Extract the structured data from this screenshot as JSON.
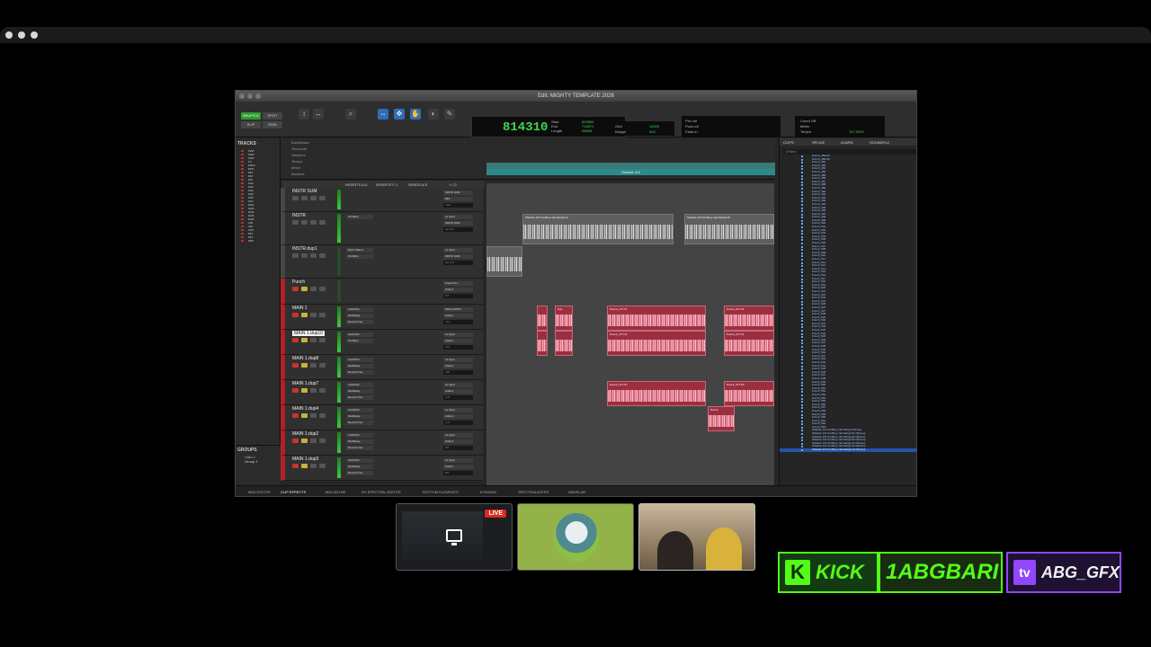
{
  "window_title": "Edit: MIGHTY TEMPLATE 2026",
  "toolbar": {
    "mode_shuffle": "SHUFFLE",
    "mode_spot": "SPOT",
    "mode_slip": "SLIP",
    "mode_grid": "GRID",
    "counter_main": "814310",
    "counter_labels": [
      "Start",
      "End",
      "Length"
    ],
    "counter_values": [
      "620864",
      "716672",
      "95808"
    ],
    "cursor_label": "Cursor",
    "cursor_value": "694516",
    "cursor_db": "-78.8dB",
    "grid_label": "Grid",
    "grid_value": "10000",
    "nudge_label": "Nudge",
    "nudge_value": "200",
    "preroll_label": "Pre-roll",
    "postroll_label": "Post-roll",
    "fade_label": "Fade-in",
    "count_off": "Count Off",
    "meter_label": "Meter",
    "tempo_label": "Tempo",
    "tempo_value": "147.0000"
  },
  "rulers": [
    "Bars|Beats",
    "Timecode",
    "Samples",
    "Tempo",
    "Meter",
    "Markers"
  ],
  "ruler_marker_text": "Default: 4/4",
  "tracks_panel": {
    "header": "TRACKS",
    "items": [
      "INST",
      "INST",
      "INST",
      "FX",
      "MAIN",
      "MNT",
      "MIX",
      "MIX",
      "MIX",
      "M12",
      "M13",
      "M14",
      "M15",
      "M16",
      "M17",
      "MAS",
      "MAS",
      "DUB",
      "DUB",
      "DUB",
      "LB1",
      "LB1",
      "VOX",
      "MIX",
      "MIX",
      "PEP"
    ]
  },
  "groups_panel": {
    "header": "GROUPS",
    "items": [
      "<ALL>",
      "Group 1"
    ]
  },
  "mix_header": [
    "INSERTS A-E",
    "INSERTS F-J",
    "SENDS A-E",
    "I / O"
  ],
  "tracks": [
    {
      "name": "INSTR SUM",
      "io": [
        "INSTR SUM",
        "MIX"
      ],
      "vol": "+0.0",
      "inserts": []
    },
    {
      "name": "INSTR",
      "io": [
        "no input",
        "INSTR SUM"
      ],
      "vol": "vol -6.2",
      "inserts": [
        "ChnStrip"
      ]
    },
    {
      "name": "INSTR.dup1",
      "io": [
        "no input",
        "INSTR SUM"
      ],
      "vol": "vol -4.2",
      "inserts": [
        "EQ3 7-Band",
        "ChnStrip"
      ]
    },
    {
      "name": "Punch",
      "io": [
        "Fresh Inf 1",
        "Artist 1"
      ],
      "vol": "0.0",
      "inserts": []
    },
    {
      "name": "MAIN 1",
      "io": [
        "MAIN AUDIO",
        "Artist 1"
      ],
      "vol": "-4.1",
      "inserts": [
        "AutoPitch",
        "ModDelay",
        "Reverb One"
      ]
    },
    {
      "name": "MAIN 1.dup10",
      "io": [
        "no input",
        "Artist 1"
      ],
      "vol": "-6.4",
      "inserts": [
        "AutoPitch",
        "ChnStrip"
      ]
    },
    {
      "name": "MAIN 1.dup8",
      "io": [
        "no input",
        "Artist 1"
      ],
      "vol": "-5.9",
      "inserts": [
        "AutoPitch",
        "ModDelay",
        "Reverb One"
      ]
    },
    {
      "name": "MAIN 1.dup7",
      "io": [
        "no input",
        "Artist 1"
      ],
      "vol": "-1.5",
      "inserts": [
        "AutoPitch",
        "ModDelay",
        "Reverb One"
      ]
    },
    {
      "name": "MAIN 1.dup4",
      "io": [
        "no input",
        "Artist 1"
      ],
      "vol": "-1.2",
      "inserts": [
        "AutoPitch",
        "ModDelay",
        "Reverb One"
      ]
    },
    {
      "name": "MAIN 1.dup2",
      "io": [
        "no input",
        "Artist 1"
      ],
      "vol": "0.0",
      "inserts": [
        "AutoPitch",
        "ModDelay",
        "Reverb One"
      ]
    },
    {
      "name": "MAIN 1.dup3",
      "io": [
        "no input",
        "Artist 1"
      ],
      "vol": "0.0",
      "inserts": [
        "AutoPitch",
        "ModDelay",
        "Reverb One"
      ]
    }
  ],
  "clips": {
    "instr_1": "Shadow 147 bruhboy varmfeirgh-14",
    "instr_2": "Shadow 147 bruhboy varmfeirgh-15",
    "punch_a": "Punch_477-37",
    "punch_b": "Pun",
    "punch_c": "Punch_477-31",
    "punch_d": "Punch_4",
    "punch_e": "Punch_477-03",
    "punch_f": "Punch"
  },
  "clips_panel": {
    "tabs": [
      "CLIPS",
      "SPLICE",
      "LEARN",
      "SOUNDFLO"
    ],
    "filter_placeholder": "(Filter)",
    "entries": [
      "Punch_469-06",
      "Punch_469-09",
      "Punch_481",
      "Punch_482",
      "Punch_483",
      "Punch_484",
      "Punch_485",
      "Punch_486",
      "Punch_487",
      "Punch_488",
      "Punch_489",
      "Punch_490",
      "Punch_491",
      "Punch_492",
      "Punch_493",
      "Punch_494",
      "Punch_495",
      "Punch_496",
      "Punch_497",
      "Punch_498",
      "Punch_499",
      "Punch_500",
      "Punch_501",
      "Punch_502",
      "Punch_503",
      "Punch_504",
      "Punch_505",
      "Punch_506",
      "Punch_507",
      "Punch_508",
      "Punch_509",
      "Punch_510",
      "Punch_511",
      "Punch_512",
      "Punch_513",
      "Punch_514",
      "Punch_515",
      "Punch_516",
      "Punch_517",
      "Punch_518",
      "Punch_519",
      "Punch_520",
      "Punch_521",
      "Punch_522",
      "Punch_523",
      "Punch_524",
      "Punch_525",
      "Punch_526",
      "Punch_527",
      "Punch_528",
      "Punch_529",
      "Punch_530",
      "Punch_531",
      "Punch_532",
      "Punch_533",
      "Punch_534",
      "Punch_535",
      "Punch_536",
      "Punch_537",
      "Punch_538",
      "Punch_539",
      "Punch_540",
      "Punch_541",
      "Punch_542",
      "Punch_543",
      "Punch_544",
      "Punch_545",
      "Punch_546",
      "Punch_547",
      "Punch_548",
      "Punch_549",
      "Punch_550",
      "Punch_551",
      "Punch_552",
      "Punch_553",
      "Punch_554",
      "Punch_555",
      "Punch_556",
      "Punch_557",
      "Punch_558",
      "Punch_559",
      "Punch_560",
      "Punch_561",
      "Punch_562",
      "Punch_563",
      "Shadow 147 bruhboy varmfeirgh (Stereo)",
      "Shadow 147 bruhboy varmfeirgh-01 (Stereo)",
      "Shadow 147 bruhboy varmfeirgh-02 (Stereo)",
      "Shadow 147 bruhboy varmfeirgh-03 (Stereo)",
      "Shadow 147 bruhboy varmfeirgh-11 (Stereo)",
      "Shadow 147 bruhboy varmfeirgh-12 (Stereo)",
      "Shadow 147 bruhboy varmfeirgh-14 (Stereo)"
    ]
  },
  "bottom_tabs": [
    "MIDI EDITOR",
    "CLIP EFFECTS",
    "MELODYNE",
    "RX SPECTRAL EDITOR",
    "RHYTHM ELEMENTS",
    "DYNAMIX",
    "SPECTRALAYERS",
    "WAVELAB"
  ],
  "stream": {
    "live_badge": "LIVE",
    "kick_label": "KICK",
    "kick_logo": "K",
    "handle": "1ABGBARI",
    "twitch_handle": "ABG_GFX",
    "twitch_logo": "tv"
  },
  "colors": {
    "accent_green": "#3fd64b",
    "track_red": "#b1202a",
    "clip_pink": "#9b2f40",
    "teal": "#2c8a8a",
    "kick_green": "#53fc18",
    "twitch_purple": "#9146ff"
  }
}
